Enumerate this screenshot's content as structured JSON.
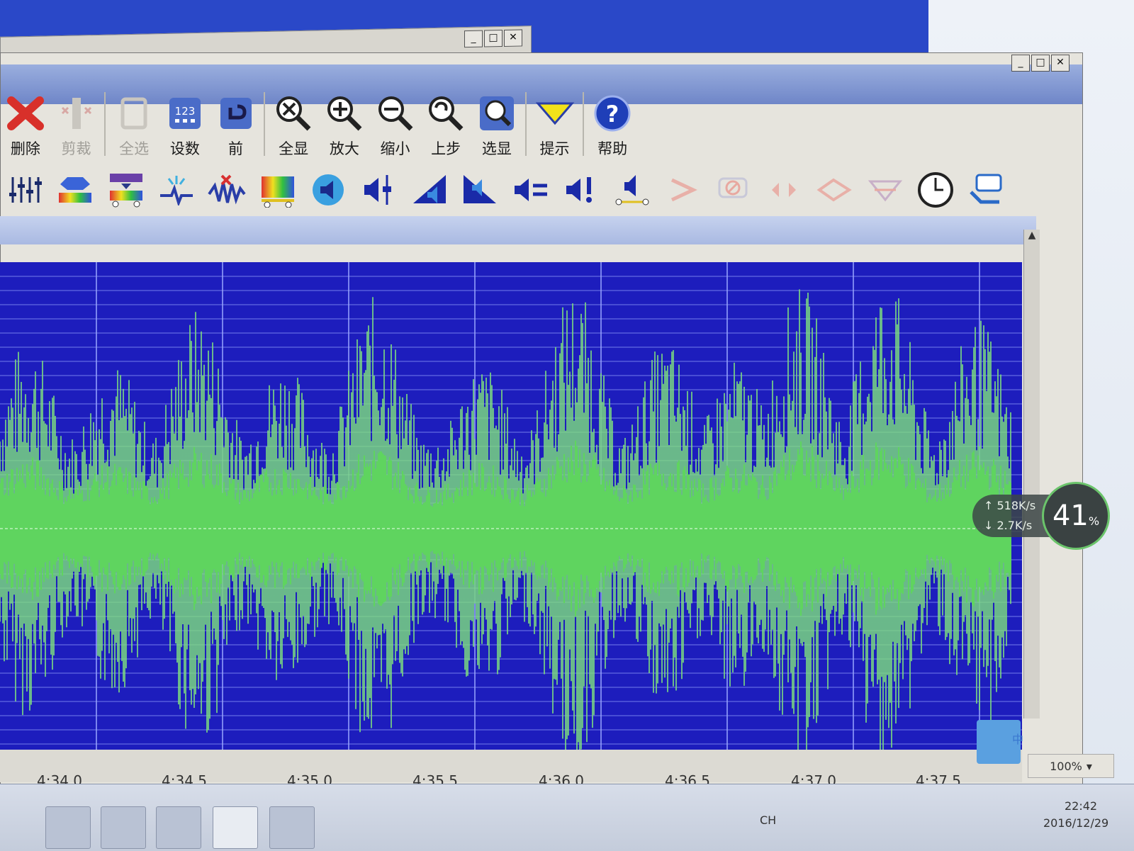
{
  "back_window": {
    "controls": [
      "_",
      "□",
      "✕"
    ]
  },
  "main_window": {
    "controls": [
      "_",
      "□",
      "✕"
    ]
  },
  "toolbar_main": [
    {
      "id": "delete",
      "label": "删除",
      "icon": "delete-x-icon",
      "enabled": true
    },
    {
      "id": "trim",
      "label": "剪裁",
      "icon": "trim-icon",
      "enabled": false
    },
    {
      "id": "select-all",
      "label": "全选",
      "icon": "select-all-icon",
      "enabled": false
    },
    {
      "id": "set-number",
      "label": "设数",
      "icon": "number-123-icon",
      "enabled": true
    },
    {
      "id": "previous",
      "label": "前",
      "icon": "previous-icon",
      "enabled": true
    },
    {
      "id": "show-all",
      "label": "全显",
      "icon": "zoom-all-icon",
      "enabled": true
    },
    {
      "id": "zoom-in",
      "label": "放大",
      "icon": "zoom-in-icon",
      "enabled": true
    },
    {
      "id": "zoom-out",
      "label": "缩小",
      "icon": "zoom-out-icon",
      "enabled": true
    },
    {
      "id": "undo-step",
      "label": "上步",
      "icon": "zoom-back-icon",
      "enabled": true
    },
    {
      "id": "show-selection",
      "label": "选显",
      "icon": "zoom-selection-icon",
      "enabled": true
    },
    {
      "id": "hint",
      "label": "提示",
      "icon": "hint-triangle-icon",
      "enabled": true
    },
    {
      "id": "help",
      "label": "帮助",
      "icon": "help-question-icon",
      "enabled": true
    }
  ],
  "toolbar_effects": [
    "equalizer-sliders-icon",
    "spectrum-icon",
    "spectrum-filter-icon",
    "spark-icon",
    "noise-remove-icon",
    "color-spectrum-icon",
    "speaker-round-icon",
    "volume-slider-icon",
    "fade-in-icon",
    "fade-out-icon",
    "volume-equal-icon",
    "volume-alert-icon",
    "volume-line-icon",
    "effect-disabled-1-icon",
    "effect-disabled-2-icon",
    "effect-disabled-3-icon",
    "effect-disabled-4-icon",
    "effect-disabled-5-icon",
    "clock-icon",
    "comment-icon"
  ],
  "waveform": {
    "wave_color": "#7ee07e",
    "background_color": "#1d1dbd",
    "grid_color": "#9aa6ff"
  },
  "time_axis": {
    "labels": [
      "4:34.0",
      "4:34.5",
      "4:35.0",
      "4:35.5",
      "4:36.0",
      "4:36.5",
      "4:37.0",
      "4:37.5"
    ]
  },
  "zoom": {
    "value": "100%"
  },
  "network_monitor": {
    "upload": "518K/s",
    "download": "2.7K/s",
    "percent": "41",
    "percent_sign": "%"
  },
  "tray": {
    "ime": "CH",
    "time": "22:42",
    "date": "2016/12/29",
    "qq_panel": "中"
  }
}
